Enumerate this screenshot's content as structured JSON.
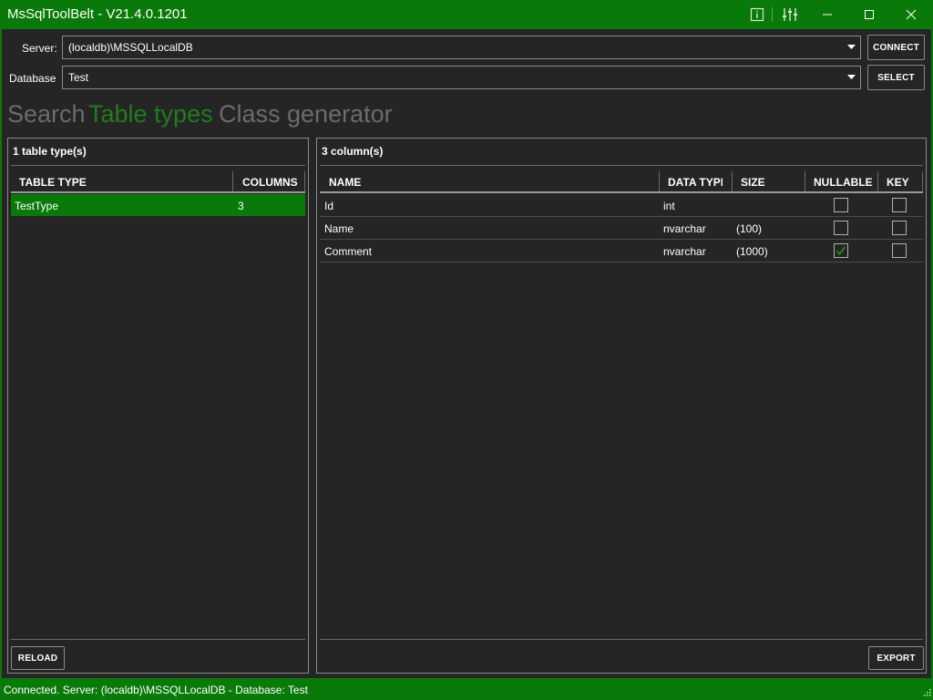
{
  "window": {
    "title": "MsSqlToolBelt - V21.4.0.1201",
    "icons": [
      "info-icon",
      "settings-sliders-icon",
      "minimize-icon",
      "maximize-icon",
      "close-icon"
    ]
  },
  "connection": {
    "server_label": "Server:",
    "server_value": "(localdb)\\MSSQLLocalDB",
    "connect_label": "CONNECT",
    "database_label": "Database",
    "database_value": "Test",
    "select_label": "SELECT"
  },
  "tabs": [
    {
      "label": "Search",
      "active": false
    },
    {
      "label": "Table types",
      "active": true
    },
    {
      "label": "Class generator",
      "active": false
    }
  ],
  "left_panel": {
    "title": "1 table type(s)",
    "columns": [
      "TABLE TYPE",
      "COLUMNS"
    ],
    "rows": [
      {
        "table_type": "TestType",
        "columns": "3",
        "selected": true
      }
    ],
    "reload_label": "RELOAD"
  },
  "right_panel": {
    "title": "3 column(s)",
    "columns": [
      "NAME",
      "DATA TYPE",
      "SIZE",
      "NULLABLE",
      "KEY"
    ],
    "rows": [
      {
        "name": "Id",
        "data_type": "int",
        "size": "",
        "nullable": false,
        "key": false
      },
      {
        "name": "Name",
        "data_type": "nvarchar",
        "size": "(100)",
        "nullable": false,
        "key": false
      },
      {
        "name": "Comment",
        "data_type": "nvarchar",
        "size": "(1000)",
        "nullable": true,
        "key": false
      }
    ],
    "export_label": "EXPORT"
  },
  "status": {
    "text": "Connected. Server: (localdb)\\MSSQLLocalDB - Database: Test"
  },
  "colors": {
    "accent": "#097a09",
    "active_tab": "#1f7d1f",
    "inactive_tab": "#6b6b6b",
    "background": "#252525"
  }
}
